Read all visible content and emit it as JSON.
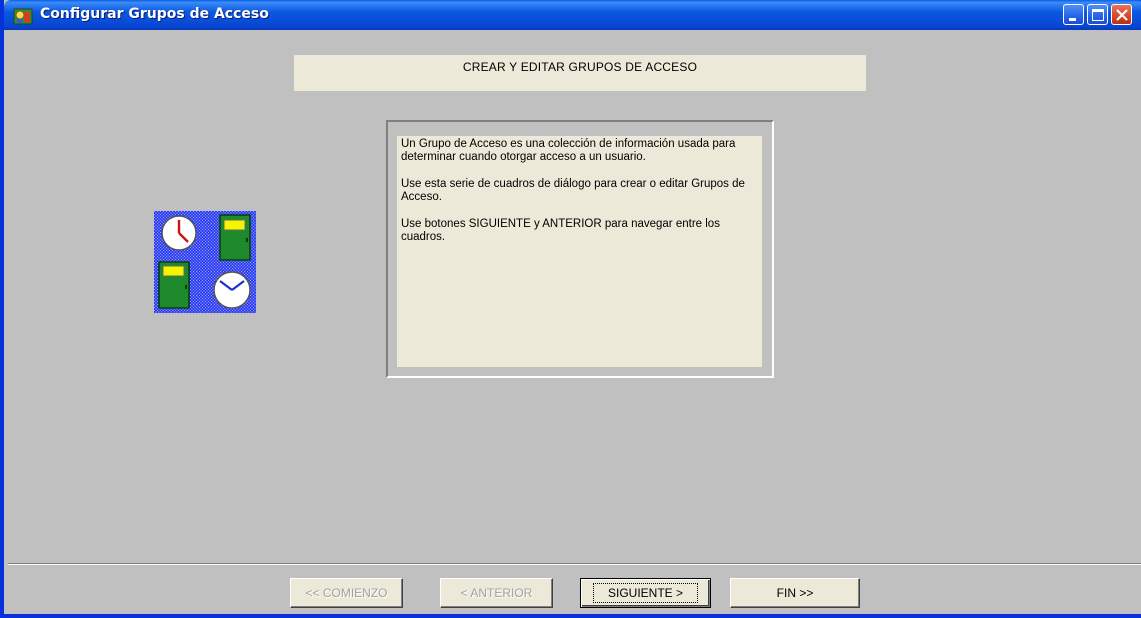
{
  "window": {
    "title": "Configurar Grupos de Acceso",
    "icon": "app-icon",
    "controls": [
      "minimize-icon",
      "maximize-icon",
      "close-icon"
    ]
  },
  "header": {
    "text": "CREAR Y EDITAR GRUPOS DE ACCESO"
  },
  "info": {
    "paragraph1": "Un Grupo de Acceso es una colección de información usada para determinar cuando otorgar acceso a un usuario.",
    "paragraph2": "Use esta serie de cuadros de diálogo para crear o editar Grupos de Acceso.",
    "paragraph3": "Use botones SIGUIENTE y ANTERIOR para navegar entre los cuadros."
  },
  "picture": {
    "icons": [
      "clock-icon",
      "door-icon"
    ]
  },
  "buttons": {
    "start": "<< COMIENZO",
    "previous": "< ANTERIOR",
    "next": "SIGUIENTE >",
    "finish": "FIN >>"
  },
  "colors": {
    "titlebar": "#0846d4",
    "panel": "#ece9d8",
    "window_bg": "#c0c0c0",
    "picture_bg": "#2b3cf0",
    "door": "#1e8a2c",
    "door_sign": "#f5f500"
  }
}
